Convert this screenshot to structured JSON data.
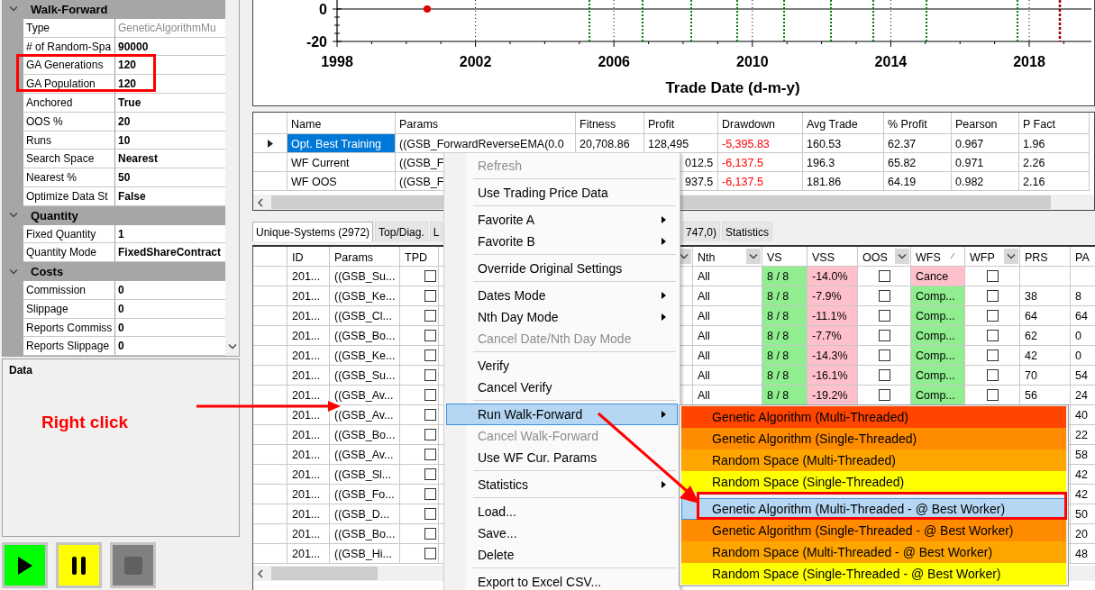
{
  "property_grid": {
    "categories": [
      {
        "title": "Walk-Forward",
        "expanded": true,
        "items": [
          {
            "name": "Type",
            "value": "GeneticAlgorithmMu",
            "readonly": true
          },
          {
            "name": "# of Random-Spa",
            "value": "90000",
            "readonly": false
          },
          {
            "name": "GA Generations",
            "value": "120",
            "readonly": false
          },
          {
            "name": "GA Population",
            "value": "120",
            "readonly": false
          },
          {
            "name": "Anchored",
            "value": "True",
            "readonly": false
          },
          {
            "name": "OOS %",
            "value": "20",
            "readonly": false
          },
          {
            "name": "Runs",
            "value": "10",
            "readonly": false
          },
          {
            "name": "Search Space",
            "value": "Nearest",
            "readonly": false
          },
          {
            "name": "Nearest %",
            "value": "50",
            "readonly": false
          },
          {
            "name": "Optimize Data St",
            "value": "False",
            "readonly": false
          }
        ]
      },
      {
        "title": "Quantity",
        "expanded": true,
        "items": [
          {
            "name": "Fixed Quantity",
            "value": "1",
            "readonly": false
          },
          {
            "name": "Quantity Mode",
            "value": "FixedShareContract",
            "readonly": false
          }
        ]
      },
      {
        "title": "Costs",
        "expanded": true,
        "items": [
          {
            "name": "Commission",
            "value": "0",
            "readonly": false
          },
          {
            "name": "Slippage",
            "value": "0",
            "readonly": false
          },
          {
            "name": "Reports Commiss",
            "value": "0",
            "readonly": false
          },
          {
            "name": "Reports Slippage",
            "value": "0",
            "readonly": false
          }
        ]
      }
    ]
  },
  "data_panel": {
    "title": "Data"
  },
  "annotation": {
    "label": "Right click"
  },
  "toolbar": [
    {
      "kind": "play",
      "disabled": false
    },
    {
      "kind": "pause",
      "disabled": false
    },
    {
      "kind": "stop",
      "disabled": true
    }
  ],
  "chart": {
    "y_labels": [
      "0",
      "-20"
    ],
    "x_labels": [
      "1998",
      "2002",
      "2006",
      "2010",
      "2014",
      "2018"
    ],
    "xlabel": "Trade Date (d-m-y)"
  },
  "results": {
    "columns": [
      "Name",
      "Params",
      "Fitness",
      "Profit",
      "Drawdown",
      "Avg Trade",
      "% Profit",
      "Pearson",
      "P Fact"
    ],
    "rows": [
      {
        "selected": true,
        "cells": [
          "Opt. Best Training",
          "((GSB_ForwardReverseEMA(0.0",
          "20,708.86",
          "128,495",
          "-5,395.83",
          "160.53",
          "62.37",
          "0.967",
          "1.96"
        ]
      },
      {
        "selected": false,
        "cells": [
          "WF Current",
          "((GSB_F",
          "",
          "012.5",
          "-6,137.5",
          "196.3",
          "65.82",
          "0.971",
          "2.26"
        ]
      },
      {
        "selected": false,
        "cells": [
          "WF OOS",
          "((GSB_F",
          "",
          "937.5",
          "-6,137.5",
          "181.86",
          "64.19",
          "0.982",
          "2.16"
        ]
      }
    ]
  },
  "tabs": [
    {
      "label": "Unique-Systems (2972)",
      "selected": true
    },
    {
      "label": "Top/Diag.",
      "selected": false
    },
    {
      "label": "L",
      "selected": false
    },
    {
      "label": "747,0)",
      "selected": false
    },
    {
      "label": "Statistics",
      "selected": false
    }
  ],
  "grid": {
    "columns": [
      {
        "label": "ID"
      },
      {
        "label": "Params"
      },
      {
        "label": "TPD"
      },
      {
        "filter": true
      },
      {
        "label": "Nth",
        "filter": true
      },
      {
        "label": "VS"
      },
      {
        "label": "VSS"
      },
      {
        "label": "OOS",
        "filter": true
      },
      {
        "label": "WFS",
        "sorted": true
      },
      {
        "label": "WFP",
        "filter": true
      },
      {
        "label": "PRS"
      },
      {
        "label": "PA"
      }
    ],
    "rows": [
      {
        "id": "201...",
        "params": "((GSB_Su...",
        "tpd": false,
        "nth": "All",
        "vs": "8 / 8",
        "vss": "-14.0%",
        "oos": false,
        "wfs": "Cance",
        "color": "#ffc0cb",
        "wfp": false
      },
      {
        "id": "201...",
        "params": "((GSB_Ke...",
        "tpd": false,
        "nth": "All",
        "vs": "8 / 8",
        "vss": "-7.9%",
        "oos": false,
        "wfs": "Comp...",
        "color": "#90ee90",
        "wfp": false,
        "prs": "38",
        "pas": "8"
      },
      {
        "id": "201...",
        "params": "((GSB_Cl...",
        "tpd": false,
        "nth": "All",
        "vs": "8 / 8",
        "vss": "-11.1%",
        "oos": false,
        "wfs": "Comp...",
        "color": "#90ee90",
        "wfp": false,
        "prs": "64",
        "pas": "64"
      },
      {
        "id": "201...",
        "params": "((GSB_Bo...",
        "tpd": false,
        "nth": "All",
        "vs": "8 / 8",
        "vss": "-7.7%",
        "oos": false,
        "wfs": "Comp...",
        "color": "#90ee90",
        "wfp": false,
        "prs": "62",
        "pas": "0"
      },
      {
        "id": "201...",
        "params": "((GSB_Ke...",
        "tpd": false,
        "nth": "All",
        "vs": "8 / 8",
        "vss": "-14.3%",
        "oos": false,
        "wfs": "Comp...",
        "color": "#90ee90",
        "wfp": false,
        "prs": "42",
        "pas": "0"
      },
      {
        "id": "201...",
        "params": "((GSB_Su...",
        "tpd": false,
        "nth": "All",
        "vs": "8 / 8",
        "vss": "-16.1%",
        "oos": false,
        "wfs": "Comp...",
        "color": "#90ee90",
        "wfp": false,
        "prs": "70",
        "pas": "54"
      },
      {
        "id": "201...",
        "params": "((GSB_Av...",
        "tpd": false,
        "nth": "All",
        "vs": "8 / 8",
        "vss": "-19.2%",
        "oos": false,
        "wfs": "Comp...",
        "color": "#90ee90",
        "wfp": false,
        "prs": "56",
        "pas": "24"
      },
      {
        "id": "201...",
        "params": "((GSB_Av...",
        "tpd": false,
        "pas": "40"
      },
      {
        "id": "201...",
        "params": "((GSB_Bo...",
        "tpd": false,
        "pas": "22"
      },
      {
        "id": "201...",
        "params": "((GSB_Av...",
        "tpd": false,
        "pas": "58"
      },
      {
        "id": "201...",
        "params": "((GSB_Sl...",
        "tpd": false,
        "pas": "42"
      },
      {
        "id": "201...",
        "params": "((GSB_Fo...",
        "tpd": false,
        "pas": "42"
      },
      {
        "id": "201...",
        "params": "((GSB_D...",
        "tpd": false,
        "pas": "50"
      },
      {
        "id": "201...",
        "params": "((GSB_Bo...",
        "tpd": false,
        "pas": "20"
      },
      {
        "id": "201...",
        "params": "((GSB_Hi...",
        "tpd": false,
        "pas": "48"
      }
    ]
  },
  "context_menu": {
    "items": [
      {
        "kind": "item",
        "label": "Refresh",
        "disabled": true,
        "submenu": false,
        "selected": false
      },
      {
        "kind": "separator"
      },
      {
        "kind": "item",
        "label": "Use Trading Price Data",
        "disabled": false,
        "submenu": false,
        "selected": false
      },
      {
        "kind": "separator"
      },
      {
        "kind": "item",
        "label": "Favorite A",
        "disabled": false,
        "submenu": true,
        "selected": false
      },
      {
        "kind": "item",
        "label": "Favorite B",
        "disabled": false,
        "submenu": true,
        "selected": false
      },
      {
        "kind": "separator"
      },
      {
        "kind": "item",
        "label": "Override Original Settings",
        "disabled": false,
        "submenu": false,
        "selected": false
      },
      {
        "kind": "separator"
      },
      {
        "kind": "item",
        "label": "Dates Mode",
        "disabled": false,
        "submenu": true,
        "selected": false
      },
      {
        "kind": "item",
        "label": "Nth Day Mode",
        "disabled": false,
        "submenu": true,
        "selected": false
      },
      {
        "kind": "item",
        "label": "Cancel Date/Nth Day Mode",
        "disabled": true,
        "submenu": false,
        "selected": false
      },
      {
        "kind": "separator"
      },
      {
        "kind": "item",
        "label": "Verify",
        "disabled": false,
        "submenu": false,
        "selected": false
      },
      {
        "kind": "item",
        "label": "Cancel Verify",
        "disabled": false,
        "submenu": false,
        "selected": false
      },
      {
        "kind": "separator"
      },
      {
        "kind": "item",
        "label": "Run Walk-Forward",
        "disabled": false,
        "submenu": true,
        "selected": true
      },
      {
        "kind": "item",
        "label": "Cancel Walk-Forward",
        "disabled": true,
        "submenu": false,
        "selected": false
      },
      {
        "kind": "item",
        "label": "Use WF Cur. Params",
        "disabled": false,
        "submenu": false,
        "selected": false
      },
      {
        "kind": "separator"
      },
      {
        "kind": "item",
        "label": "Statistics",
        "disabled": false,
        "submenu": true,
        "selected": false
      },
      {
        "kind": "separator"
      },
      {
        "kind": "item",
        "label": "Load...",
        "disabled": false,
        "submenu": false,
        "selected": false
      },
      {
        "kind": "item",
        "label": "Save...",
        "disabled": false,
        "submenu": false,
        "selected": false
      },
      {
        "kind": "item",
        "label": "Delete",
        "disabled": false,
        "submenu": false,
        "selected": false
      },
      {
        "kind": "separator"
      },
      {
        "kind": "item",
        "label": "Export to Excel CSV...",
        "disabled": false,
        "submenu": false,
        "selected": false
      }
    ]
  },
  "submenu": {
    "items": [
      {
        "kind": "item",
        "label": "Genetic Algorithm (Multi-Threaded)",
        "color": "#ff4500",
        "selected": false
      },
      {
        "kind": "item",
        "label": "Genetic Algorithm (Single-Threaded)",
        "color": "#ff8c00",
        "selected": false
      },
      {
        "kind": "item",
        "label": "Random Space (Multi-Threaded)",
        "color": "#ffa500",
        "selected": false
      },
      {
        "kind": "item",
        "label": "Random Space (Single-Threaded)",
        "color": "#ffff00",
        "selected": false
      },
      {
        "kind": "separator"
      },
      {
        "kind": "item",
        "label": "Genetic Algorithm (Multi-Threaded - @ Best Worker)",
        "selected": true
      },
      {
        "kind": "item",
        "label": "Genetic Algorithm (Single-Threaded - @ Best Worker)",
        "color": "#ff8c00",
        "selected": false
      },
      {
        "kind": "item",
        "label": "Random Space (Multi-Threaded - @ Best Worker)",
        "color": "#ffa500",
        "selected": false
      },
      {
        "kind": "item",
        "label": "Random Space (Single-Threaded - @ Best Worker)",
        "color": "#ffff00",
        "selected": false
      }
    ]
  }
}
